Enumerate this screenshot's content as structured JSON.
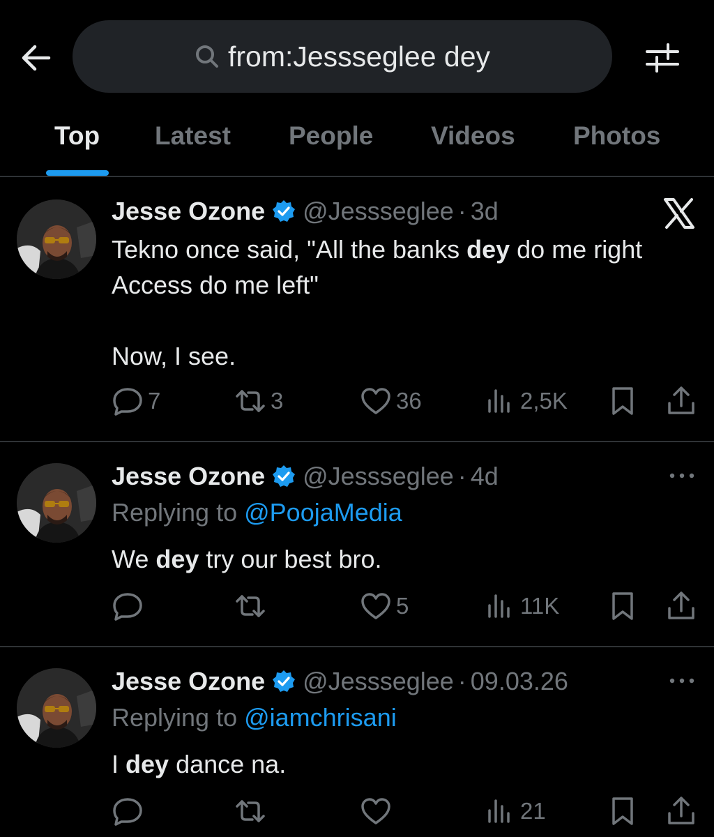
{
  "search": {
    "query": "from:Jessseglee dey"
  },
  "tabs": [
    {
      "label": "Top",
      "active": true
    },
    {
      "label": "Latest"
    },
    {
      "label": "People"
    },
    {
      "label": "Videos"
    },
    {
      "label": "Photos"
    }
  ],
  "colors": {
    "accent": "#1d9bf0",
    "background": "#000000",
    "muted": "#71767b",
    "text": "#e7e9ea"
  },
  "icons": [
    "back-arrow-icon",
    "search-icon",
    "filter-icon",
    "verified-icon",
    "x-logo-icon",
    "more-icon",
    "reply-icon",
    "retweet-icon",
    "like-icon",
    "views-icon",
    "bookmark-icon",
    "share-icon"
  ],
  "tweets": [
    {
      "name": "Jesse Ozone",
      "handle": "@Jessseglee",
      "dot": "·",
      "time": "3d",
      "text_parts": [
        "Tekno once said, \"All the banks ",
        "dey",
        " do me right\nAccess do me left\"\n\nNow, I see."
      ],
      "replies": "7",
      "retweets": "3",
      "likes": "36",
      "views": "2,5K"
    },
    {
      "name": "Jesse Ozone",
      "handle": "@Jessseglee",
      "dot": "·",
      "time": "4d",
      "reply_prefix": "Replying to ",
      "reply_to": "@PoojaMedia",
      "text_parts": [
        "We ",
        "dey",
        " try our best bro."
      ],
      "replies": "",
      "retweets": "",
      "likes": "5",
      "views": "11K"
    },
    {
      "name": "Jesse Ozone",
      "handle": "@Jessseglee",
      "dot": "·",
      "time": "09.03.26",
      "reply_prefix": "Replying to ",
      "reply_to": "@iamchrisani",
      "text_parts": [
        "I ",
        "dey",
        " dance na."
      ],
      "replies": "",
      "retweets": "",
      "likes": "",
      "views": "21"
    }
  ]
}
